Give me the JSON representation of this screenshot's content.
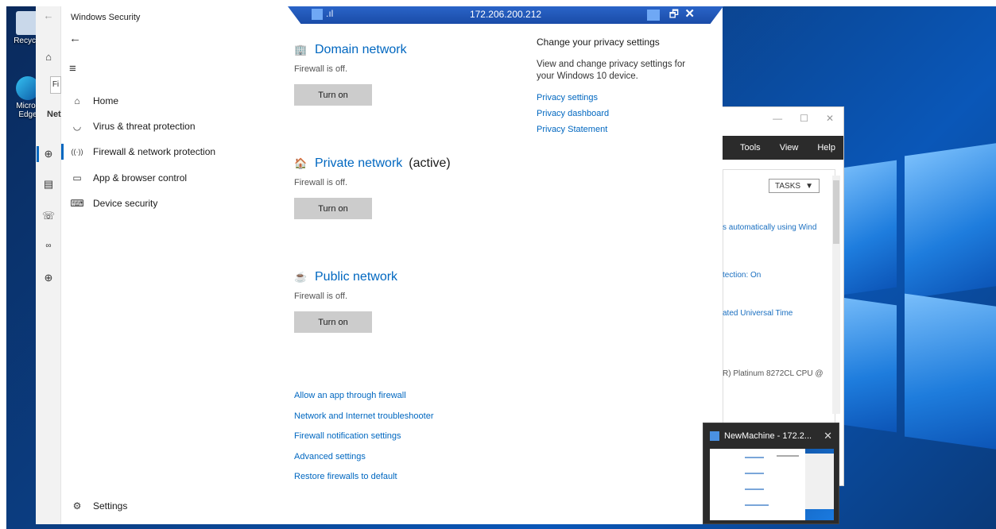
{
  "desktop": {
    "icons": [
      {
        "label": "Recycle",
        "icon": "recycle-bin-icon"
      },
      {
        "label": "Micros Edge",
        "icon": "edge-icon"
      }
    ]
  },
  "rdp_bar": {
    "ip": "172.206.200.212",
    "restore_glyph": "🗗",
    "close_glyph": "✕"
  },
  "background_window": {
    "menu": [
      "Tools",
      "View",
      "Help"
    ],
    "tasks_label": "TASKS",
    "lines": [
      "s automatically using Wind",
      "tection: On",
      "ated Universal Time",
      "R) Platinum 8272CL CPU @"
    ],
    "controls": [
      "—",
      "☐",
      "✕"
    ]
  },
  "window": {
    "title": "Windows Security",
    "side_partial": "Net",
    "search_partial": "Fi",
    "back_glyph": "←",
    "hamburger_glyph": "≡",
    "nav": [
      {
        "label": "Home",
        "icon": "⌂"
      },
      {
        "label": "Virus & threat protection",
        "icon": "🛡"
      },
      {
        "label": "Firewall & network protection",
        "icon": "((·))"
      },
      {
        "label": "App & browser control",
        "icon": "▭"
      },
      {
        "label": "Device security",
        "icon": "⌨"
      }
    ],
    "settings_label": "Settings"
  },
  "networks": [
    {
      "name": "Domain network",
      "active": "",
      "status": "Firewall is off.",
      "button": "Turn on",
      "icon": "domain-network-icon"
    },
    {
      "name": "Private network",
      "active": "(active)",
      "status": "Firewall is off.",
      "button": "Turn on",
      "icon": "private-network-icon"
    },
    {
      "name": "Public network",
      "active": "",
      "status": "Firewall is off.",
      "button": "Turn on",
      "icon": "public-network-icon"
    }
  ],
  "links": [
    "Allow an app through firewall",
    "Network and Internet troubleshooter",
    "Firewall notification settings",
    "Advanced settings",
    "Restore firewalls to default"
  ],
  "privacy": {
    "heading": "Change your privacy settings",
    "description": "View and change privacy settings for your Windows 10 device.",
    "links": [
      "Privacy settings",
      "Privacy dashboard",
      "Privacy Statement"
    ]
  },
  "preview": {
    "title": "NewMachine - 172.2...",
    "close": "✕"
  },
  "colors": {
    "accent": "#0067c0",
    "rdp_bar": "#1a4ca8",
    "button": "#cccccc"
  }
}
